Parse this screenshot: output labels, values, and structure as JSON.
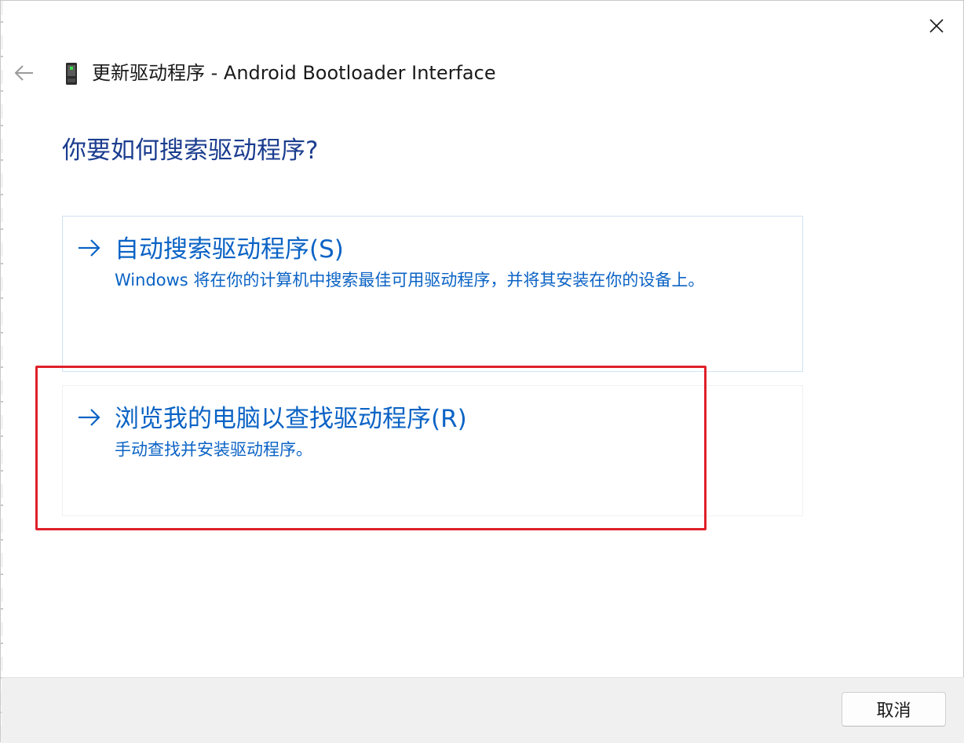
{
  "window": {
    "title": "更新驱动程序 - Android Bootloader Interface",
    "close_icon": "close-icon",
    "back_icon": "back-arrow-icon",
    "device_icon": "phone-device-icon"
  },
  "main": {
    "heading": "你要如何搜索驱动程序?",
    "options": [
      {
        "title": "自动搜索驱动程序(S)",
        "description": "Windows 将在你的计算机中搜索最佳可用驱动程序，并将其安装在你的设备上。",
        "icon": "arrow-right-icon"
      },
      {
        "title": "浏览我的电脑以查找驱动程序(R)",
        "description": "手动查找并安装驱动程序。",
        "icon": "arrow-right-icon"
      }
    ]
  },
  "footer": {
    "cancel_label": "取消"
  },
  "colors": {
    "link_blue": "#0b63c5",
    "heading_blue": "#1b3d8f",
    "highlight_red": "#e0202a",
    "footer_bg": "#f0f0f0"
  }
}
